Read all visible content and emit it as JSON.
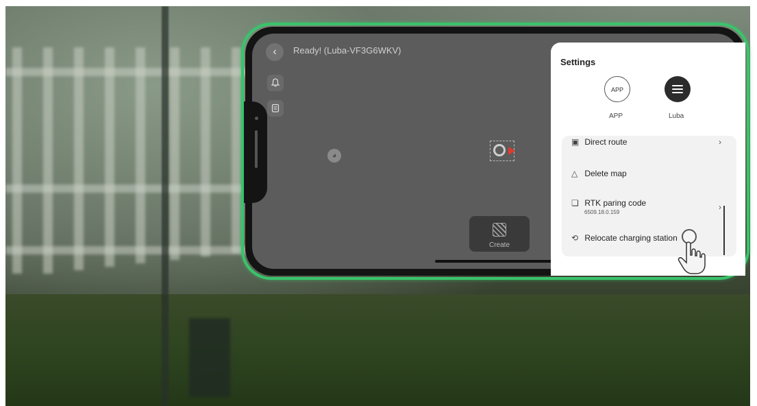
{
  "app": {
    "title": "Ready! (Luba-VF3G6WKV)"
  },
  "map": {
    "back_icon": "chevron-left-icon",
    "bell_icon": "bell-icon",
    "clipboard_icon": "clipboard-icon",
    "create_label": "Create"
  },
  "settings": {
    "title": "Settings",
    "options": [
      {
        "circle": "APP",
        "label": "APP"
      },
      {
        "circle": "",
        "label": "Luba"
      }
    ],
    "items": [
      {
        "label": "Direct route",
        "icon": "route-icon"
      },
      {
        "label": "Delete map",
        "icon": "trash-icon"
      },
      {
        "label": "RTK paring code",
        "sub": "6509.18.0.159",
        "icon": "copy-icon"
      },
      {
        "label": "Relocate charging station",
        "icon": "refresh-icon"
      }
    ]
  },
  "colors": {
    "phone_glow": "#39c46b",
    "mower_arrow": "#e03a2e"
  }
}
